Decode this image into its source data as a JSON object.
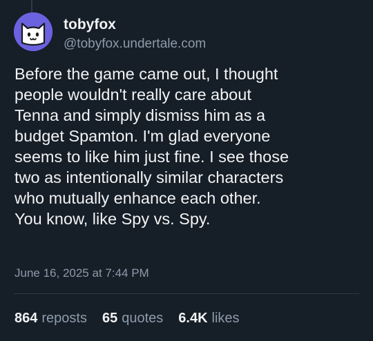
{
  "author": {
    "display_name": "tobyfox",
    "handle": "@tobyfox.undertale.com"
  },
  "avatar": {
    "icon": "white-cat-avatar-icon",
    "background_color": "#6b62e0"
  },
  "post": {
    "text": "Before the game came out, I thought\npeople wouldn't really care about\nTenna and simply dismiss him as a\nbudget Spamton. I'm glad everyone\nseems to like him just fine. I see those\ntwo as intentionally similar characters\nwho mutually enhance each other.\nYou know, like Spy vs. Spy.",
    "timestamp": "June 16, 2025 at 7:44 PM"
  },
  "stats": {
    "reposts_count": "864",
    "reposts_label": "reposts",
    "quotes_count": "65",
    "quotes_label": "quotes",
    "likes_count": "6.4K",
    "likes_label": "likes"
  },
  "colors": {
    "background": "#161e27",
    "text_primary": "#f1f3f5",
    "text_secondary": "#8d9bab",
    "divider": "#2e3a49"
  }
}
